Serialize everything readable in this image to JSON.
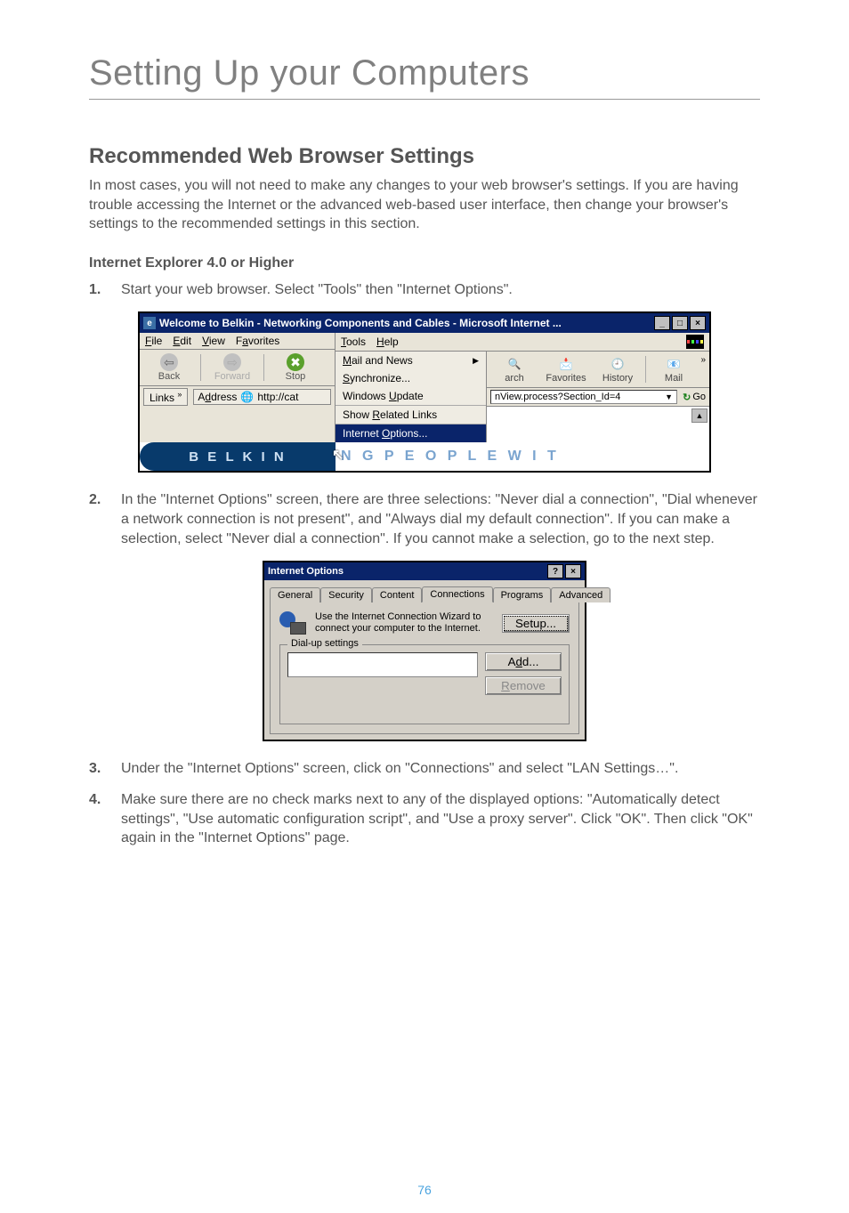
{
  "chapterTitle": "Setting Up your Computers",
  "sectionHeading": "Recommended Web Browser Settings",
  "introParagraph": "In most cases, you will not need to make any changes to your web browser's settings. If you are having trouble accessing the Internet or the advanced web-based user interface, then change your browser's settings to the recommended settings in this section.",
  "subHeading": "Internet Explorer 4.0 or Higher",
  "steps": {
    "s1": {
      "num": "1.",
      "text": "Start your web browser. Select \"Tools\" then \"Internet Options\"."
    },
    "s2": {
      "num": "2.",
      "text": "In the \"Internet Options\" screen, there are three selections: \"Never dial a connection\", \"Dial whenever a network connection is not present\", and \"Always dial my default connection\". If you can make a selection, select \"Never dial a connection\". If you cannot make a selection, go to the next step."
    },
    "s3": {
      "num": "3.",
      "text": "Under the \"Internet Options\" screen, click on \"Connections\" and select \"LAN Settings…\"."
    },
    "s4": {
      "num": "4.",
      "text": "Make sure there are no check marks next to any of the displayed options: \"Automatically detect settings\", \"Use automatic configuration script\", and \"Use a proxy server\". Click \"OK\". Then click \"OK\" again in the \"Internet Options\" page."
    }
  },
  "fig1": {
    "windowTitle": "Welcome to Belkin - Networking Components and Cables - Microsoft Internet ...",
    "menubar": {
      "file": "File",
      "edit": "Edit",
      "view": "View",
      "favorites": "Favorites",
      "tools": "Tools",
      "help": "Help"
    },
    "toolbarLeft": {
      "back": "Back",
      "forward": "Forward",
      "stop": "Stop"
    },
    "linksLabel": "Links",
    "addressLabel": "Address",
    "addressValue": "http://cat",
    "toolsMenu": {
      "mailNews": "Mail and News",
      "synchronize": "Synchronize...",
      "windowsUpdate": "Windows Update",
      "showRelated": "Show Related Links",
      "internetOptions": "Internet Options..."
    },
    "toolbarRight": {
      "search": "arch",
      "favorites": "Favorites",
      "history": "History",
      "mail": "Mail"
    },
    "addressRight": "nView.process?Section_Id=4",
    "goLabel": "Go",
    "logo": "B E L K I N",
    "tagline": "N G   P E O P L E   W I T"
  },
  "fig2": {
    "title": "Internet Options",
    "tabs": {
      "general": "General",
      "security": "Security",
      "content": "Content",
      "connections": "Connections",
      "programs": "Programs",
      "advanced": "Advanced"
    },
    "wizardText": "Use the Internet Connection Wizard to connect your computer to the Internet.",
    "setupBtn": "Setup...",
    "groupLegend": "Dial-up settings",
    "addBtn": "Add...",
    "removeBtn": "Remove"
  },
  "pageNumber": "76"
}
